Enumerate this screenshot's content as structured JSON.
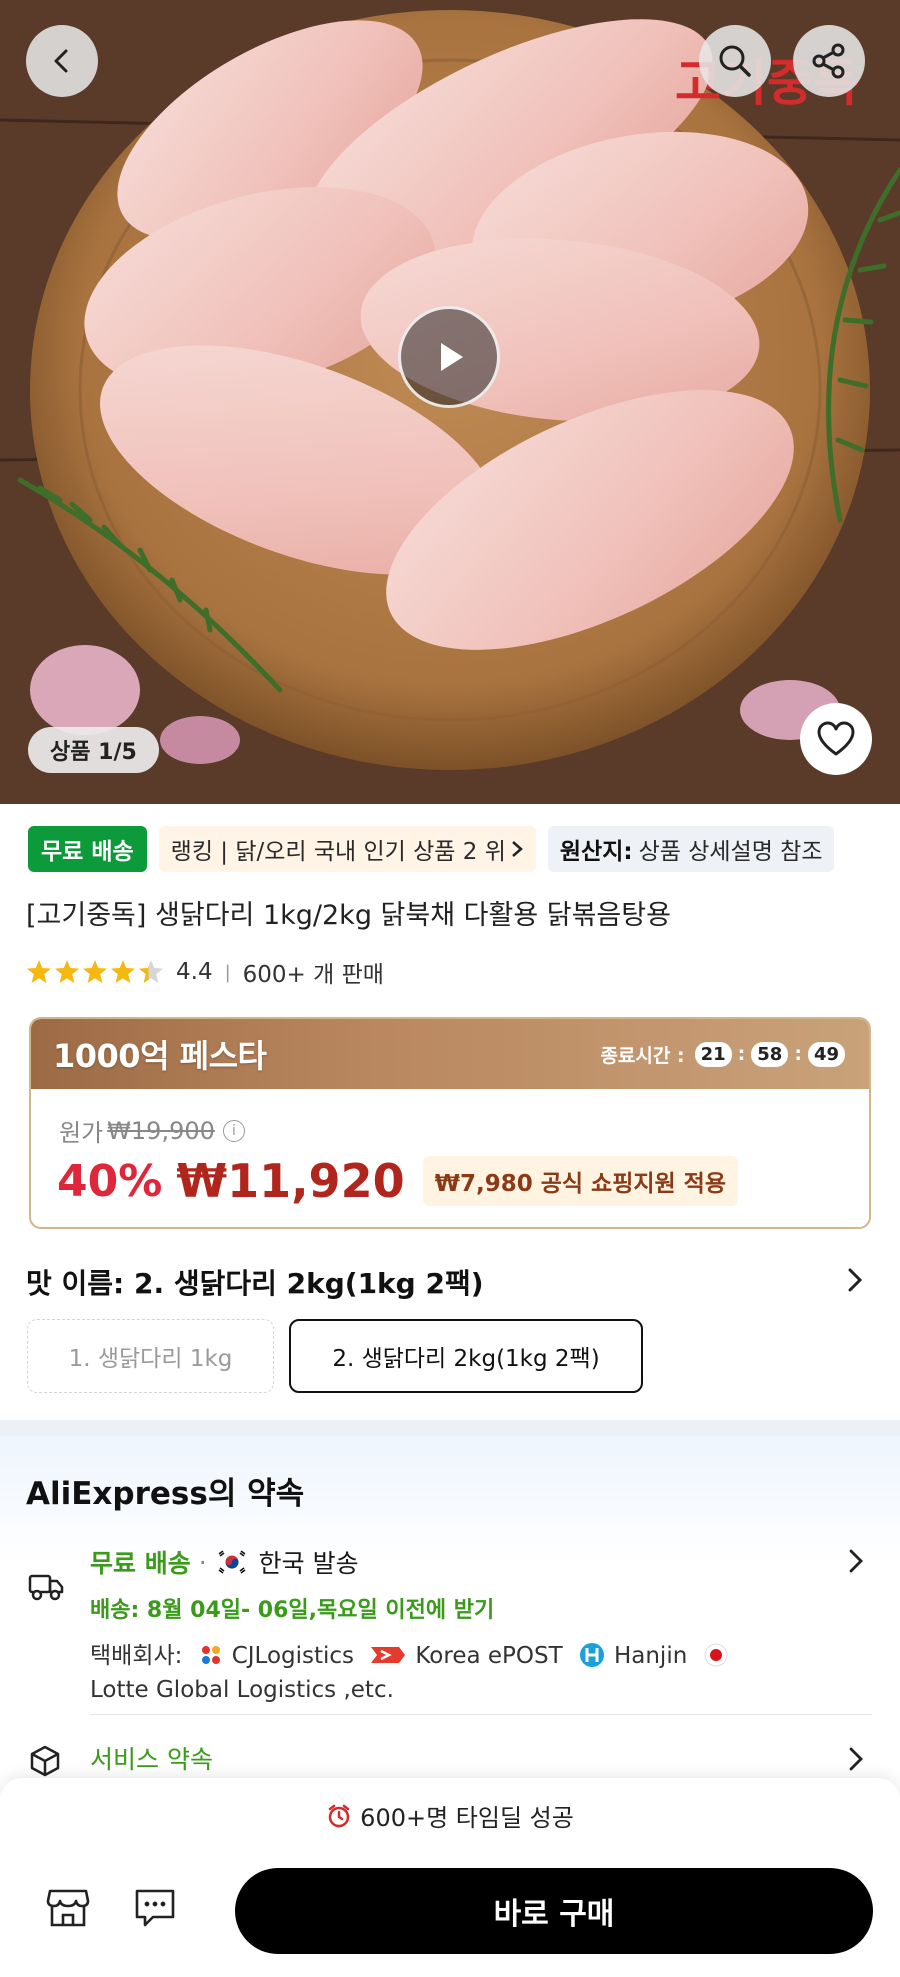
{
  "hero": {
    "logo_text": "고기중독",
    "page_indicator": "상품 1/5",
    "icons": [
      "back-icon",
      "search-icon",
      "share-icon",
      "play-icon",
      "heart-icon"
    ]
  },
  "badges": {
    "free_shipping": "무료 배송",
    "ranking": "랭킹 | 닭/오리 국내 인기 상품 2 위",
    "origin_label": "원산지:",
    "origin_value": "상품 상세설명 참조"
  },
  "product": {
    "title": "[고기중독] 생닭다리 1kg/2kg 닭북채 다활용 닭볶음탕용",
    "rating": "4.4",
    "rating_value": 4.4,
    "sold": "600+ 개 판매"
  },
  "promo": {
    "title": "1000억 페스타",
    "timer_label": "종료시간 :",
    "timer_h": "21",
    "timer_m": "58",
    "timer_s": "49",
    "original_label": "원가",
    "original_price": "₩19,900",
    "discount": "40%",
    "price": "₩11,920",
    "subsidy": "₩7,980 공식 쇼핑지원 적용"
  },
  "options": {
    "label": "맛 이름: 2. 생닭다리 2kg(1kg 2팩)",
    "items": [
      "1. 생닭다리 1kg",
      "2. 생닭다리 2kg(1kg 2팩)"
    ],
    "selected": "2. 생닭다리 2kg(1kg 2팩)"
  },
  "promise": {
    "title": "AliExpress의 약속",
    "free_shipping": "무료 배송",
    "ship_from": "한국 발송",
    "delivery_date": "배송: 8월 04일- 06일,목요일 이전에 받기",
    "carrier_label": "택배회사:",
    "carriers": [
      "CJLogistics",
      "Korea ePOST",
      "Hanjin",
      "Lotte Global Logistics ,etc."
    ],
    "service": "서비스 약속"
  },
  "bottom": {
    "timedeal": "600+명 타임딜 성공",
    "buy": "바로 구매"
  },
  "colors": {
    "free_green": "#0c9a3b",
    "accent_red": "#e0263a",
    "promo_brown": "#9c6b45",
    "buy_black": "#000000"
  }
}
